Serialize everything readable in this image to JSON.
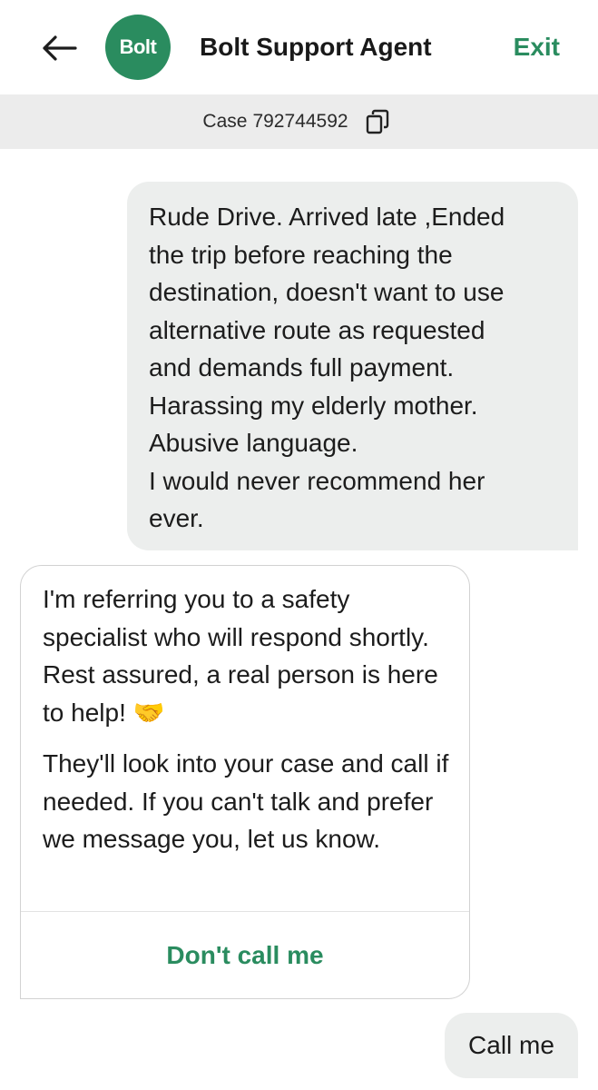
{
  "header": {
    "back_icon": "arrow-left-icon",
    "logo_text": "Bolt",
    "logo_color": "#2a8c5f",
    "agent_name": "Bolt Support Agent",
    "exit_label": "Exit"
  },
  "case": {
    "label": "Case",
    "number": "792744592",
    "copy_icon": "copy-icon"
  },
  "messages": [
    {
      "sender": "user",
      "text": "Rude Drive. Arrived late ,Ended\nthe trip before reaching the\ndestination, doesn't want to use\nalternative route as requested\nand demands full payment.\nHarassing my elderly mother.\nAbusive language.\nI would never recommend her\never."
    },
    {
      "sender": "agent",
      "paragraphs": [
        "I'm referring you to a safety specialist who will respond shortly. Rest assured, a real person is here to help! 🤝",
        "They'll look into your case and call if needed. If you can't talk and prefer we message you, let us know."
      ],
      "action_label": "Don't call me"
    },
    {
      "sender": "user",
      "text": "Call me"
    }
  ],
  "colors": {
    "accent": "#2a8c5f",
    "user_bubble": "#eceeed",
    "case_bar": "#ececec"
  }
}
